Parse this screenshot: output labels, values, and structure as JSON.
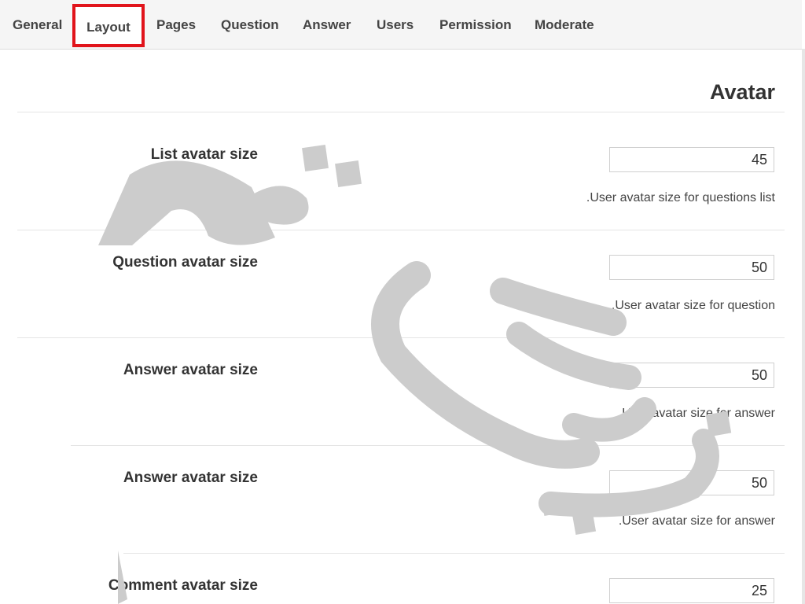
{
  "tabs": [
    {
      "label": "General"
    },
    {
      "label": "Layout",
      "active": true
    },
    {
      "label": "Pages"
    },
    {
      "label": "Question"
    },
    {
      "label": "Answer"
    },
    {
      "label": "Users"
    },
    {
      "label": "Permission"
    },
    {
      "label": "Moderate"
    }
  ],
  "section": {
    "title": "Avatar"
  },
  "fields": [
    {
      "label": "List avatar size",
      "value": "45",
      "help": ".User avatar size for questions list"
    },
    {
      "label": "Question avatar size",
      "value": "50",
      "help": ".User avatar size for question"
    },
    {
      "label": "Answer avatar size",
      "value": "50",
      "help": ".User avatar size for answer"
    },
    {
      "label": "Answer avatar size",
      "value": "50",
      "help": ".User avatar size for answer"
    },
    {
      "label": "Comment avatar size",
      "value": "25",
      "help": ""
    }
  ],
  "colors": {
    "active_tab_border": "#e1141b",
    "watermark": "#cccccc"
  }
}
